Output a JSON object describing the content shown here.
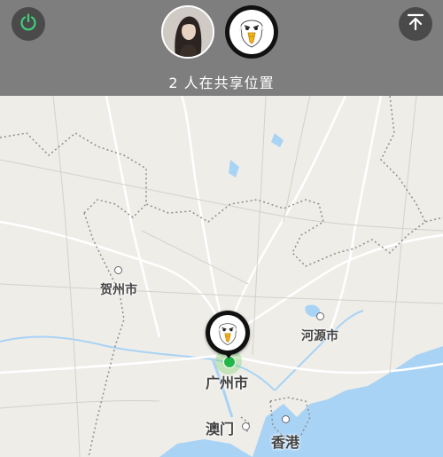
{
  "header": {
    "share_status": "2 人在共享位置",
    "power_icon": "power-icon",
    "collapse_icon": "arrow-up-to-top-icon"
  },
  "participants": [
    {
      "name": "participant-woman-avatar",
      "icon": "woman-portrait"
    },
    {
      "name": "participant-eagle-avatar",
      "icon": "eagle-icon"
    }
  ],
  "map": {
    "cities": {
      "hezhou": "贺州市",
      "heyuan": "河源市",
      "guangzhou": "广州市",
      "macau": "澳门",
      "hongkong": "香港"
    },
    "user_marker_icon": "eagle-icon"
  },
  "colors": {
    "accent_green": "#22b548",
    "power_green": "#3fcf7a",
    "water": "#a9d3f5",
    "land": "#efede8"
  }
}
